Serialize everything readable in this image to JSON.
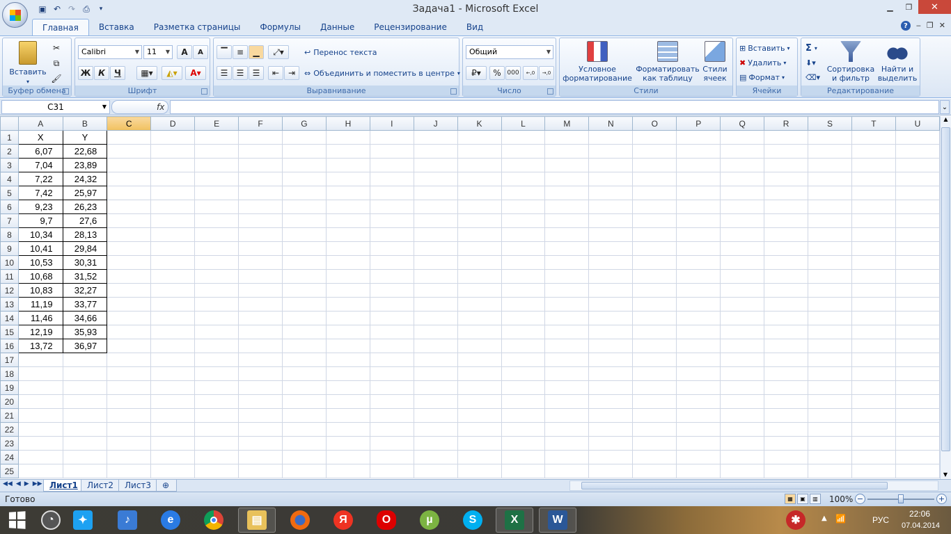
{
  "window": {
    "title": "Задача1 - Microsoft Excel",
    "close": "✕",
    "minimize": "‒",
    "restore": "❐"
  },
  "qat": {
    "save": "💾",
    "undo": "↶",
    "redo": "↷",
    "print_preview": "🔍",
    "customize": "▾"
  },
  "tabs": [
    "Главная",
    "Вставка",
    "Разметка страницы",
    "Формулы",
    "Данные",
    "Рецензирование",
    "Вид"
  ],
  "ribbon": {
    "clipboard": {
      "label": "Буфер обмена",
      "paste": "Вставить"
    },
    "font": {
      "label": "Шрифт",
      "name": "Calibri",
      "size": "11",
      "bold": "Ж",
      "italic": "К",
      "underline": "Ч",
      "grow": "A",
      "shrink": "A"
    },
    "alignment": {
      "label": "Выравнивание",
      "wrap": "Перенос текста",
      "merge": "Объединить и поместить в центре"
    },
    "number": {
      "label": "Число",
      "format": "Общий",
      "percent": "%",
      "thousands": "000",
      "inc_dec": ",0 ,00",
      "dec_dec": ",00 ,0"
    },
    "styles": {
      "label": "Стили",
      "conditional": "Условное форматирование",
      "as_table": "Форматировать как таблицу",
      "cell_styles": "Стили ячеек"
    },
    "cells": {
      "label": "Ячейки",
      "insert": "Вставить",
      "delete": "Удалить",
      "format": "Формат"
    },
    "editing": {
      "label": "Редактирование",
      "sum": "Σ",
      "sort": "Сортировка и фильтр",
      "find": "Найти и выделить"
    }
  },
  "formula_bar": {
    "name_box": "C31",
    "fx": "fx",
    "value": ""
  },
  "columns": [
    "A",
    "B",
    "C",
    "D",
    "E",
    "F",
    "G",
    "H",
    "I",
    "J",
    "K",
    "L",
    "M",
    "N",
    "O",
    "P",
    "Q",
    "R",
    "S",
    "T",
    "U"
  ],
  "selected_column": "C",
  "cells": {
    "header": {
      "A": "X",
      "B": "Y"
    },
    "rows": [
      [
        "6,07",
        "22,68"
      ],
      [
        "7,04",
        "23,89"
      ],
      [
        "7,22",
        "24,32"
      ],
      [
        "7,42",
        "25,97"
      ],
      [
        "9,23",
        "26,23"
      ],
      [
        "9,7",
        "27,6"
      ],
      [
        "10,34",
        "28,13"
      ],
      [
        "10,41",
        "29,84"
      ],
      [
        "10,53",
        "30,31"
      ],
      [
        "10,68",
        "31,52"
      ],
      [
        "10,83",
        "32,27"
      ],
      [
        "11,19",
        "33,77"
      ],
      [
        "11,46",
        "34,66"
      ],
      [
        "12,19",
        "35,93"
      ],
      [
        "13,72",
        "36,97"
      ]
    ],
    "total_rows": 25
  },
  "sheets": [
    "Лист1",
    "Лист2",
    "Лист3"
  ],
  "active_sheet": "Лист1",
  "status": {
    "text": "Готово",
    "zoom": "100%"
  },
  "taskbar": {
    "lang": "РУС",
    "time": "22:06",
    "date": "07.04.2014"
  }
}
